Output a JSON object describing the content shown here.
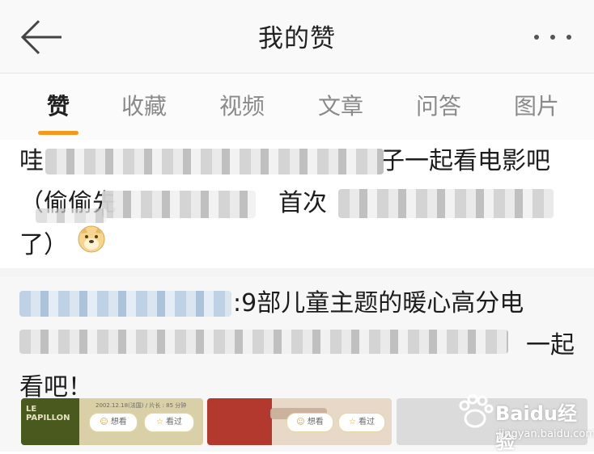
{
  "header": {
    "title": "我的赞",
    "back_icon": "arrow-left-icon",
    "more_icon": "more-dots-icon"
  },
  "tabs": [
    {
      "label": "赞",
      "active": true
    },
    {
      "label": "收藏",
      "active": false
    },
    {
      "label": "视频",
      "active": false
    },
    {
      "label": "文章",
      "active": false
    },
    {
      "label": "问答",
      "active": false
    },
    {
      "label": "图片",
      "active": false
    }
  ],
  "accent_color": "#f39a1e",
  "post": {
    "line1_start": "哇",
    "line1_end": "子一起看电影吧",
    "line2_start": "（偷偷先",
    "line2_mid": "首次",
    "line3": "了）",
    "emoji": "doge-emoji-icon"
  },
  "repost": {
    "headline": ":9部儿童主题的暖心高分电",
    "line2_end": "一起",
    "line3": "看吧！"
  },
  "cards": [
    {
      "poster_title": "LE PAPILLON",
      "meta": "2002.12.18(法国) / 片长 : 85 分钟",
      "want_label": "想看",
      "seen_label": "看过"
    },
    {
      "want_label": "想看",
      "seen_label": "看过"
    }
  ],
  "watermark": {
    "brand": "Baidu经验",
    "url": "jingyan.baidu.com"
  }
}
